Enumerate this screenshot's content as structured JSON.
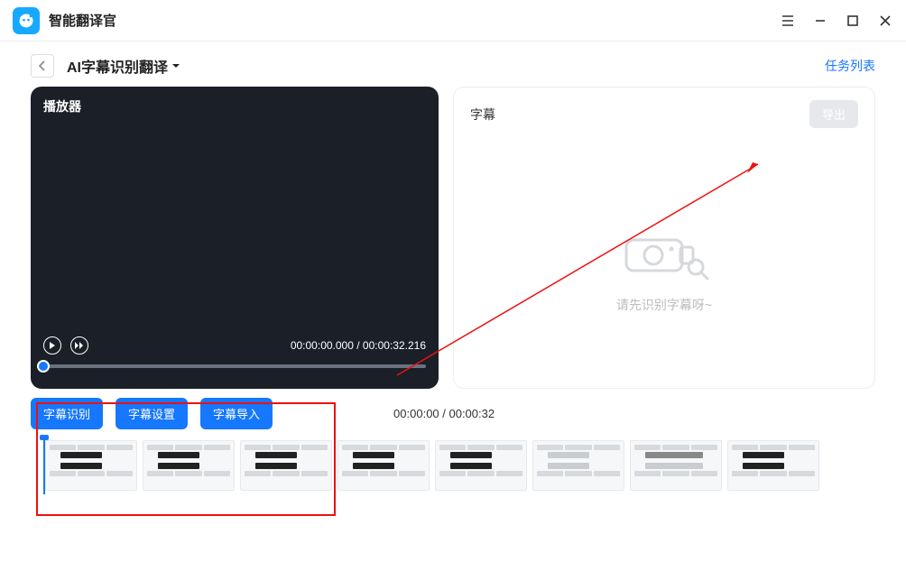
{
  "app": {
    "title": "智能翻译官"
  },
  "breadcrumb": {
    "title": "AI字幕识别翻译",
    "task_list": "任务列表"
  },
  "player": {
    "title": "播放器",
    "current": "00:00:00.000",
    "sep": " / ",
    "total": "00:00:32.216"
  },
  "subtitle_panel": {
    "title": "字幕",
    "export": "导出",
    "empty": "请先识别字幕呀~"
  },
  "buttons": {
    "recognize": "字幕识别",
    "settings": "字幕设置",
    "import": "字幕导入"
  },
  "timeline": {
    "time": "00:00:00 / 00:00:32"
  }
}
